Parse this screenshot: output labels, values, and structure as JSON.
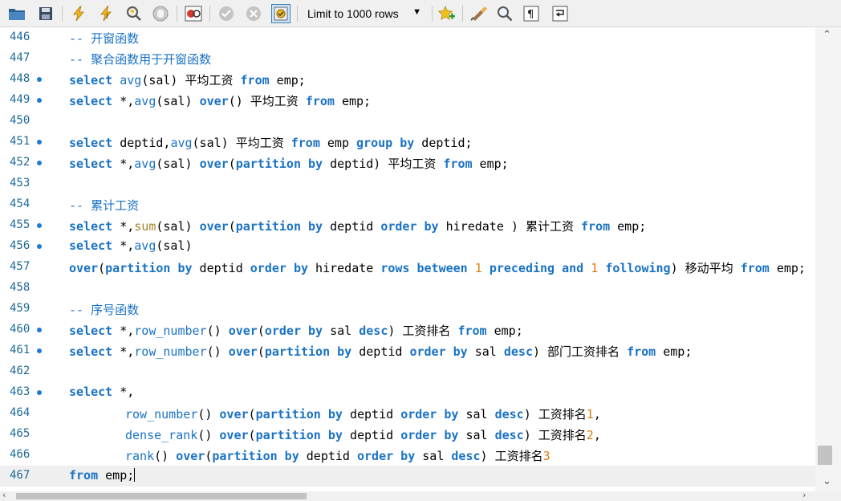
{
  "toolbar": {
    "limit_label": "Limit to 1000 rows",
    "icons": [
      "open-folder-icon",
      "save-icon",
      "execute-icon",
      "execute-current-icon",
      "explain-icon",
      "stop-icon",
      "toggle-continue-on-error-icon",
      "commit-icon",
      "rollback-icon",
      "autocommit-icon",
      "limit-rows-dropdown",
      "add-snippet-icon",
      "beautify-icon",
      "find-icon",
      "invisible-chars-icon",
      "word-wrap-icon"
    ]
  },
  "colors": {
    "keyword": "#1a72c4",
    "comment": "#1a72c4",
    "number": "#e07a10",
    "line_number": "#1e6a99",
    "gold_function": "#a8842d"
  },
  "lines": [
    {
      "num": "446",
      "dot": false,
      "indent": false,
      "tokens": [
        {
          "t": "-- 开窗函数",
          "c": "comment"
        }
      ]
    },
    {
      "num": "447",
      "dot": false,
      "indent": false,
      "tokens": [
        {
          "t": "-- 聚合函数用于开窗函数",
          "c": "comment"
        }
      ]
    },
    {
      "num": "448",
      "dot": true,
      "indent": false,
      "tokens": [
        {
          "t": "select",
          "c": "keyword"
        },
        {
          "t": " ",
          "c": "plain"
        },
        {
          "t": "avg",
          "c": "function"
        },
        {
          "t": "(sal) 平均工资 ",
          "c": "plain"
        },
        {
          "t": "from",
          "c": "keyword"
        },
        {
          "t": " emp;",
          "c": "plain"
        }
      ]
    },
    {
      "num": "449",
      "dot": true,
      "indent": false,
      "tokens": [
        {
          "t": "select",
          "c": "keyword"
        },
        {
          "t": " *,",
          "c": "plain"
        },
        {
          "t": "avg",
          "c": "function"
        },
        {
          "t": "(sal) ",
          "c": "plain"
        },
        {
          "t": "over",
          "c": "keyword"
        },
        {
          "t": "() 平均工资 ",
          "c": "plain"
        },
        {
          "t": "from",
          "c": "keyword"
        },
        {
          "t": " emp;",
          "c": "plain"
        }
      ]
    },
    {
      "num": "450",
      "dot": false,
      "indent": false,
      "tokens": []
    },
    {
      "num": "451",
      "dot": true,
      "indent": false,
      "tokens": [
        {
          "t": "select",
          "c": "keyword"
        },
        {
          "t": " deptid,",
          "c": "plain"
        },
        {
          "t": "avg",
          "c": "function"
        },
        {
          "t": "(sal) 平均工资 ",
          "c": "plain"
        },
        {
          "t": "from",
          "c": "keyword"
        },
        {
          "t": " emp ",
          "c": "plain"
        },
        {
          "t": "group by",
          "c": "keyword"
        },
        {
          "t": " deptid;",
          "c": "plain"
        }
      ]
    },
    {
      "num": "452",
      "dot": true,
      "indent": false,
      "tokens": [
        {
          "t": "select",
          "c": "keyword"
        },
        {
          "t": " *,",
          "c": "plain"
        },
        {
          "t": "avg",
          "c": "function"
        },
        {
          "t": "(sal) ",
          "c": "plain"
        },
        {
          "t": "over",
          "c": "keyword"
        },
        {
          "t": "(",
          "c": "plain"
        },
        {
          "t": "partition by",
          "c": "keyword"
        },
        {
          "t": " deptid) 平均工资 ",
          "c": "plain"
        },
        {
          "t": "from",
          "c": "keyword"
        },
        {
          "t": " emp;",
          "c": "plain"
        }
      ]
    },
    {
      "num": "453",
      "dot": false,
      "indent": false,
      "tokens": []
    },
    {
      "num": "454",
      "dot": false,
      "indent": false,
      "tokens": [
        {
          "t": "-- 累计工资",
          "c": "comment"
        }
      ]
    },
    {
      "num": "455",
      "dot": true,
      "indent": false,
      "tokens": [
        {
          "t": "select",
          "c": "keyword"
        },
        {
          "t": " *,",
          "c": "plain"
        },
        {
          "t": "sum",
          "c": "function-gold"
        },
        {
          "t": "(sal) ",
          "c": "plain"
        },
        {
          "t": "over",
          "c": "keyword"
        },
        {
          "t": "(",
          "c": "plain"
        },
        {
          "t": "partition by",
          "c": "keyword"
        },
        {
          "t": " deptid ",
          "c": "plain"
        },
        {
          "t": "order by",
          "c": "keyword"
        },
        {
          "t": " hiredate ) 累计工资 ",
          "c": "plain"
        },
        {
          "t": "from",
          "c": "keyword"
        },
        {
          "t": " emp;",
          "c": "plain"
        }
      ]
    },
    {
      "num": "456",
      "dot": true,
      "indent": false,
      "tokens": [
        {
          "t": "select",
          "c": "keyword"
        },
        {
          "t": " *,",
          "c": "plain"
        },
        {
          "t": "avg",
          "c": "function"
        },
        {
          "t": "(sal)",
          "c": "plain"
        }
      ]
    },
    {
      "num": "457",
      "dot": false,
      "indent": false,
      "tokens": [
        {
          "t": "over",
          "c": "keyword"
        },
        {
          "t": "(",
          "c": "plain"
        },
        {
          "t": "partition by",
          "c": "keyword"
        },
        {
          "t": " deptid ",
          "c": "plain"
        },
        {
          "t": "order by",
          "c": "keyword"
        },
        {
          "t": " hiredate ",
          "c": "plain"
        },
        {
          "t": "rows between",
          "c": "keyword"
        },
        {
          "t": " ",
          "c": "plain"
        },
        {
          "t": "1",
          "c": "number"
        },
        {
          "t": " ",
          "c": "plain"
        },
        {
          "t": "preceding and",
          "c": "keyword"
        },
        {
          "t": " ",
          "c": "plain"
        },
        {
          "t": "1",
          "c": "number"
        },
        {
          "t": " ",
          "c": "plain"
        },
        {
          "t": "following",
          "c": "keyword"
        },
        {
          "t": ") 移动平均 ",
          "c": "plain"
        },
        {
          "t": "from",
          "c": "keyword"
        },
        {
          "t": " emp;",
          "c": "plain"
        }
      ]
    },
    {
      "num": "458",
      "dot": false,
      "indent": false,
      "tokens": []
    },
    {
      "num": "459",
      "dot": false,
      "indent": false,
      "tokens": [
        {
          "t": "-- 序号函数",
          "c": "comment"
        }
      ]
    },
    {
      "num": "460",
      "dot": true,
      "indent": false,
      "tokens": [
        {
          "t": "select",
          "c": "keyword"
        },
        {
          "t": " *,",
          "c": "plain"
        },
        {
          "t": "row_number",
          "c": "function"
        },
        {
          "t": "() ",
          "c": "plain"
        },
        {
          "t": "over",
          "c": "keyword"
        },
        {
          "t": "(",
          "c": "plain"
        },
        {
          "t": "order by",
          "c": "keyword"
        },
        {
          "t": " sal ",
          "c": "plain"
        },
        {
          "t": "desc",
          "c": "keyword"
        },
        {
          "t": ") 工资排名 ",
          "c": "plain"
        },
        {
          "t": "from",
          "c": "keyword"
        },
        {
          "t": " emp;",
          "c": "plain"
        }
      ]
    },
    {
      "num": "461",
      "dot": true,
      "indent": false,
      "tokens": [
        {
          "t": "select",
          "c": "keyword"
        },
        {
          "t": " *,",
          "c": "plain"
        },
        {
          "t": "row_number",
          "c": "function"
        },
        {
          "t": "() ",
          "c": "plain"
        },
        {
          "t": "over",
          "c": "keyword"
        },
        {
          "t": "(",
          "c": "plain"
        },
        {
          "t": "partition by",
          "c": "keyword"
        },
        {
          "t": " deptid ",
          "c": "plain"
        },
        {
          "t": "order by",
          "c": "keyword"
        },
        {
          "t": " sal ",
          "c": "plain"
        },
        {
          "t": "desc",
          "c": "keyword"
        },
        {
          "t": ") 部门工资排名 ",
          "c": "plain"
        },
        {
          "t": "from",
          "c": "keyword"
        },
        {
          "t": " emp;",
          "c": "plain"
        }
      ]
    },
    {
      "num": "462",
      "dot": false,
      "indent": false,
      "tokens": []
    },
    {
      "num": "463",
      "dot": true,
      "indent": false,
      "tokens": [
        {
          "t": "select",
          "c": "keyword"
        },
        {
          "t": " *,",
          "c": "plain"
        }
      ]
    },
    {
      "num": "464",
      "dot": false,
      "indent": true,
      "tokens": [
        {
          "t": "row_number",
          "c": "function"
        },
        {
          "t": "() ",
          "c": "plain"
        },
        {
          "t": "over",
          "c": "keyword"
        },
        {
          "t": "(",
          "c": "plain"
        },
        {
          "t": "partition by",
          "c": "keyword"
        },
        {
          "t": " deptid ",
          "c": "plain"
        },
        {
          "t": "order by",
          "c": "keyword"
        },
        {
          "t": " sal ",
          "c": "plain"
        },
        {
          "t": "desc",
          "c": "keyword"
        },
        {
          "t": ") 工资排名",
          "c": "plain"
        },
        {
          "t": "1",
          "c": "number"
        },
        {
          "t": ",",
          "c": "plain"
        }
      ]
    },
    {
      "num": "465",
      "dot": false,
      "indent": true,
      "tokens": [
        {
          "t": "dense_rank",
          "c": "function"
        },
        {
          "t": "() ",
          "c": "plain"
        },
        {
          "t": "over",
          "c": "keyword"
        },
        {
          "t": "(",
          "c": "plain"
        },
        {
          "t": "partition by",
          "c": "keyword"
        },
        {
          "t": " deptid ",
          "c": "plain"
        },
        {
          "t": "order by",
          "c": "keyword"
        },
        {
          "t": " sal ",
          "c": "plain"
        },
        {
          "t": "desc",
          "c": "keyword"
        },
        {
          "t": ") 工资排名",
          "c": "plain"
        },
        {
          "t": "2",
          "c": "number"
        },
        {
          "t": ",",
          "c": "plain"
        }
      ]
    },
    {
      "num": "466",
      "dot": false,
      "indent": true,
      "tokens": [
        {
          "t": "rank",
          "c": "function"
        },
        {
          "t": "() ",
          "c": "plain"
        },
        {
          "t": "over",
          "c": "keyword"
        },
        {
          "t": "(",
          "c": "plain"
        },
        {
          "t": "partition by",
          "c": "keyword"
        },
        {
          "t": " deptid ",
          "c": "plain"
        },
        {
          "t": "order by",
          "c": "keyword"
        },
        {
          "t": " sal ",
          "c": "plain"
        },
        {
          "t": "desc",
          "c": "keyword"
        },
        {
          "t": ") 工资排名",
          "c": "plain"
        },
        {
          "t": "3",
          "c": "number"
        }
      ]
    },
    {
      "num": "467",
      "dot": false,
      "indent": false,
      "current": true,
      "tokens": [
        {
          "t": "from",
          "c": "keyword"
        },
        {
          "t": " emp;",
          "c": "plain"
        }
      ]
    }
  ]
}
